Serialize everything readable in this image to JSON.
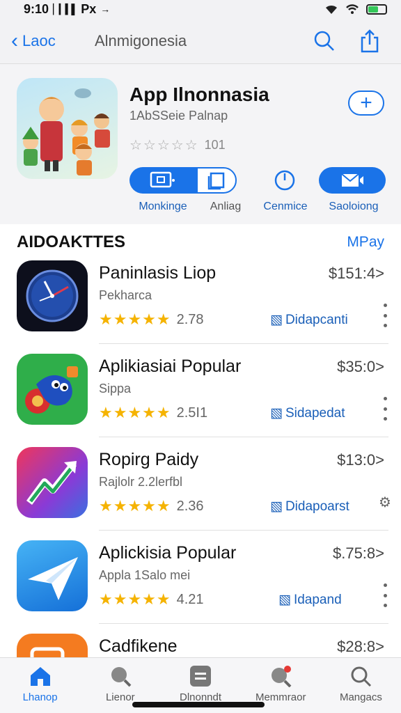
{
  "status": {
    "time": "9:10",
    "carrier": "Px",
    "signal_glyph": "▏▎▍▌",
    "location_glyph": "→"
  },
  "nav": {
    "back_label": "Laoc",
    "title": "Alnmigonesia"
  },
  "header": {
    "app_title": "App Ilnonnasia",
    "app_subtitle": "1AbSSeie Palnap",
    "rating_text": "101",
    "actions": [
      {
        "label": "Monkinge",
        "icon": "cast-icon"
      },
      {
        "label": "Anliag",
        "icon": "stack-icon"
      },
      {
        "label": "Cenmice",
        "icon": "clock-icon"
      },
      {
        "label": "Saoloiong",
        "icon": "mail-icon"
      }
    ]
  },
  "section": {
    "title": "AIDOAKTTES",
    "link": "MPay"
  },
  "apps": [
    {
      "name": "Paninlasis Liop",
      "subtitle": "Pekharca",
      "price": "$151:4>",
      "score": "2.78",
      "download_label": "Didapcanti",
      "icon": "clock-app-icon"
    },
    {
      "name": "Aplikiasiai Popular",
      "subtitle": "Sippa",
      "price": "$35:0>",
      "score": "2.5I1",
      "download_label": "Sidapedat",
      "icon": "game-app-icon"
    },
    {
      "name": "Ropirg Paidy",
      "subtitle": "Rajlolr 2.2lerfbl",
      "price": "$13:0>",
      "score": "2.36",
      "download_label": "Didapoarst",
      "icon": "trend-app-icon"
    },
    {
      "name": "Aplickisia Popular",
      "subtitle": "Appla 1Salo mei",
      "price": "$.75:8>",
      "score": "4.21",
      "download_label": "Idapand",
      "icon": "send-app-icon"
    },
    {
      "name": "Cadfikene",
      "subtitle": "",
      "price": "$28:8>",
      "score": "",
      "download_label": "",
      "icon": "video-app-icon"
    }
  ],
  "tabs": [
    {
      "label": "Lhanop",
      "icon": "home-icon"
    },
    {
      "label": "Lienor",
      "icon": "search-icon"
    },
    {
      "label": "Dlnonndt",
      "icon": "menu-icon"
    },
    {
      "label": "Memmraor",
      "icon": "notification-icon"
    },
    {
      "label": "Mangacs",
      "icon": "search-icon"
    }
  ],
  "colors": {
    "accent": "#1a73e8",
    "star": "#f5b301",
    "background": "#f4f4f6"
  }
}
